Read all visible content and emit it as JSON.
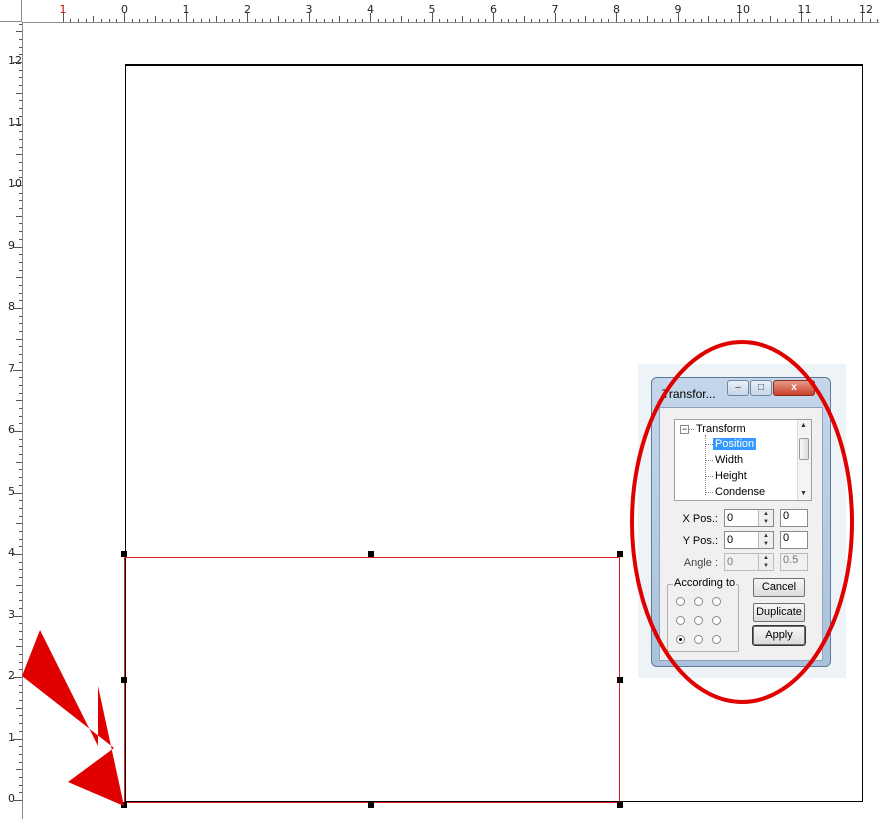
{
  "ruler": {
    "top_labels": [
      "1",
      "0",
      "1",
      "2",
      "3",
      "4",
      "5",
      "6",
      "7",
      "8",
      "9",
      "10",
      "11",
      "12"
    ],
    "left_labels": [
      "12",
      "11",
      "10",
      "9",
      "8",
      "7",
      "6",
      "5",
      "4",
      "3",
      "2",
      "1",
      "0"
    ]
  },
  "dialog": {
    "title": "Transfor...",
    "minimize_label": "–",
    "maximize_label": "□",
    "close_label": "x",
    "tree": {
      "root_label": "Transform",
      "expander": "−",
      "items": [
        "Position",
        "Width",
        "Height",
        "Condense"
      ],
      "selected": "Position"
    },
    "fields": {
      "xpos_label": "X Pos.:",
      "xpos_value": "0",
      "xpos_extra": "0",
      "ypos_label": "Y Pos.:",
      "ypos_value": "0",
      "ypos_extra": "0",
      "angle_label": "Angle :",
      "angle_value": "0",
      "angle_extra": "0.5"
    },
    "according_label": "According to",
    "according_selected": "bottom-left",
    "buttons": {
      "cancel": "Cancel",
      "duplicate": "Duplicate",
      "apply": "Apply"
    }
  },
  "colors": {
    "annotation": "#e00000",
    "selection": "#e02020",
    "tree_selected": "#3399ff"
  }
}
